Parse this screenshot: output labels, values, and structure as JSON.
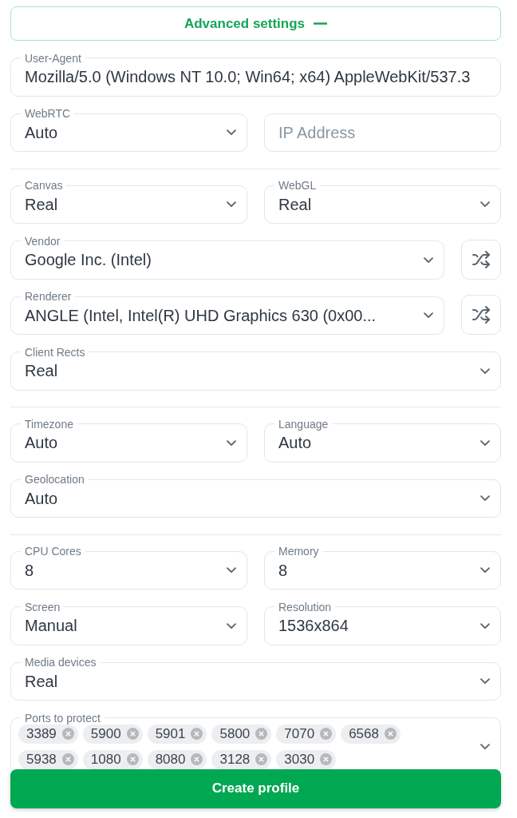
{
  "advanced_settings": {
    "label": "Advanced settings",
    "expanded": true
  },
  "sections": [
    {
      "rows": [
        {
          "fields": [
            {
              "kind": "input",
              "label": "User-Agent",
              "value": "Mozilla/5.0 (Windows NT 10.0; Win64; x64) AppleWebKit/537.3"
            }
          ]
        },
        {
          "fields": [
            {
              "kind": "select",
              "label": "WebRTC",
              "value": "Auto"
            },
            {
              "kind": "input",
              "placeholder": "IP Address"
            }
          ]
        }
      ]
    },
    {
      "rows": [
        {
          "fields": [
            {
              "kind": "select",
              "label": "Canvas",
              "value": "Real"
            },
            {
              "kind": "select",
              "label": "WebGL",
              "value": "Real"
            }
          ]
        },
        {
          "fields": [
            {
              "kind": "select",
              "label": "Vendor",
              "value": "Google Inc. (Intel)"
            },
            {
              "kind": "shuffle"
            }
          ]
        },
        {
          "fields": [
            {
              "kind": "select",
              "label": "Renderer",
              "value": "ANGLE (Intel, Intel(R) UHD Graphics 630 (0x00..."
            },
            {
              "kind": "shuffle"
            }
          ]
        },
        {
          "fields": [
            {
              "kind": "select",
              "label": "Client Rects",
              "value": "Real"
            }
          ]
        }
      ]
    },
    {
      "rows": [
        {
          "fields": [
            {
              "kind": "select",
              "label": "Timezone",
              "value": "Auto"
            },
            {
              "kind": "select",
              "label": "Language",
              "value": "Auto"
            }
          ]
        },
        {
          "fields": [
            {
              "kind": "select",
              "label": "Geolocation",
              "value": "Auto"
            }
          ]
        }
      ]
    },
    {
      "rows": [
        {
          "fields": [
            {
              "kind": "select",
              "label": "CPU Cores",
              "value": "8"
            },
            {
              "kind": "select",
              "label": "Memory",
              "value": "8"
            }
          ]
        },
        {
          "fields": [
            {
              "kind": "select",
              "label": "Screen",
              "value": "Manual"
            },
            {
              "kind": "select",
              "label": "Resolution",
              "value": "1536x864"
            }
          ]
        },
        {
          "fields": [
            {
              "kind": "select",
              "label": "Media devices",
              "value": "Real"
            }
          ]
        },
        {
          "fields": [
            {
              "kind": "tags",
              "label": "Ports to protect",
              "tags": [
                "3389",
                "5900",
                "5901",
                "5800",
                "7070",
                "6568",
                "5938",
                "1080",
                "8080",
                "3128",
                "3030"
              ]
            }
          ]
        }
      ]
    }
  ],
  "submit_button": {
    "label": "Create profile"
  }
}
